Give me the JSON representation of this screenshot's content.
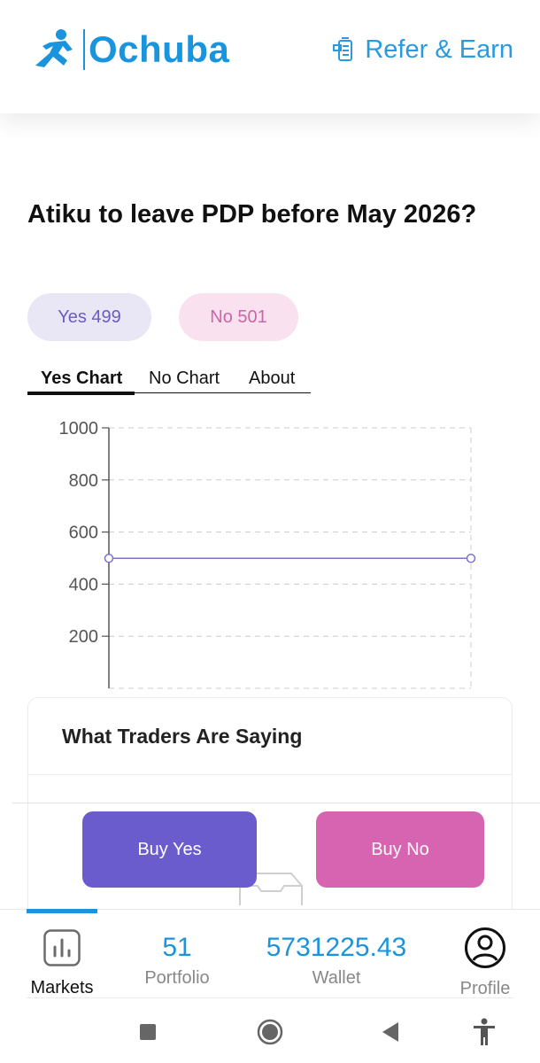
{
  "header": {
    "brand": "Ochuba",
    "refer_label": "Refer & Earn",
    "brand_color": "#1a94dc"
  },
  "market": {
    "question": "Atiku to leave PDP before May 2026?",
    "yes_pill": "Yes 499",
    "no_pill": "No 501"
  },
  "tabs": [
    {
      "label": "Yes Chart",
      "active": true
    },
    {
      "label": "No Chart",
      "active": false
    },
    {
      "label": "About",
      "active": false
    }
  ],
  "chart_data": {
    "type": "line",
    "y_ticks": [
      "1000",
      "800",
      "600",
      "400",
      "200"
    ],
    "ylim": [
      0,
      1000
    ],
    "grid": true,
    "series": [
      {
        "values": [
          499,
          499
        ],
        "color": "#7b73c9"
      }
    ]
  },
  "traders": {
    "title": "What Traders Are Saying"
  },
  "actions": {
    "buy_yes": "Buy Yes",
    "buy_no": "Buy No",
    "yes_color": "#6a5ccc",
    "no_color": "#d664b1"
  },
  "bottom_nav": {
    "markets_label": "Markets",
    "portfolio_value": "51",
    "portfolio_label": "Portfolio",
    "wallet_value": "5731225.43",
    "wallet_label": "Wallet",
    "profile_label": "Profile"
  },
  "icons": {
    "logo": "runner-logo-icon",
    "refer": "referral-icon",
    "markets": "bar-chart-icon",
    "profile": "user-circle-icon",
    "empty": "empty-tray-icon"
  }
}
